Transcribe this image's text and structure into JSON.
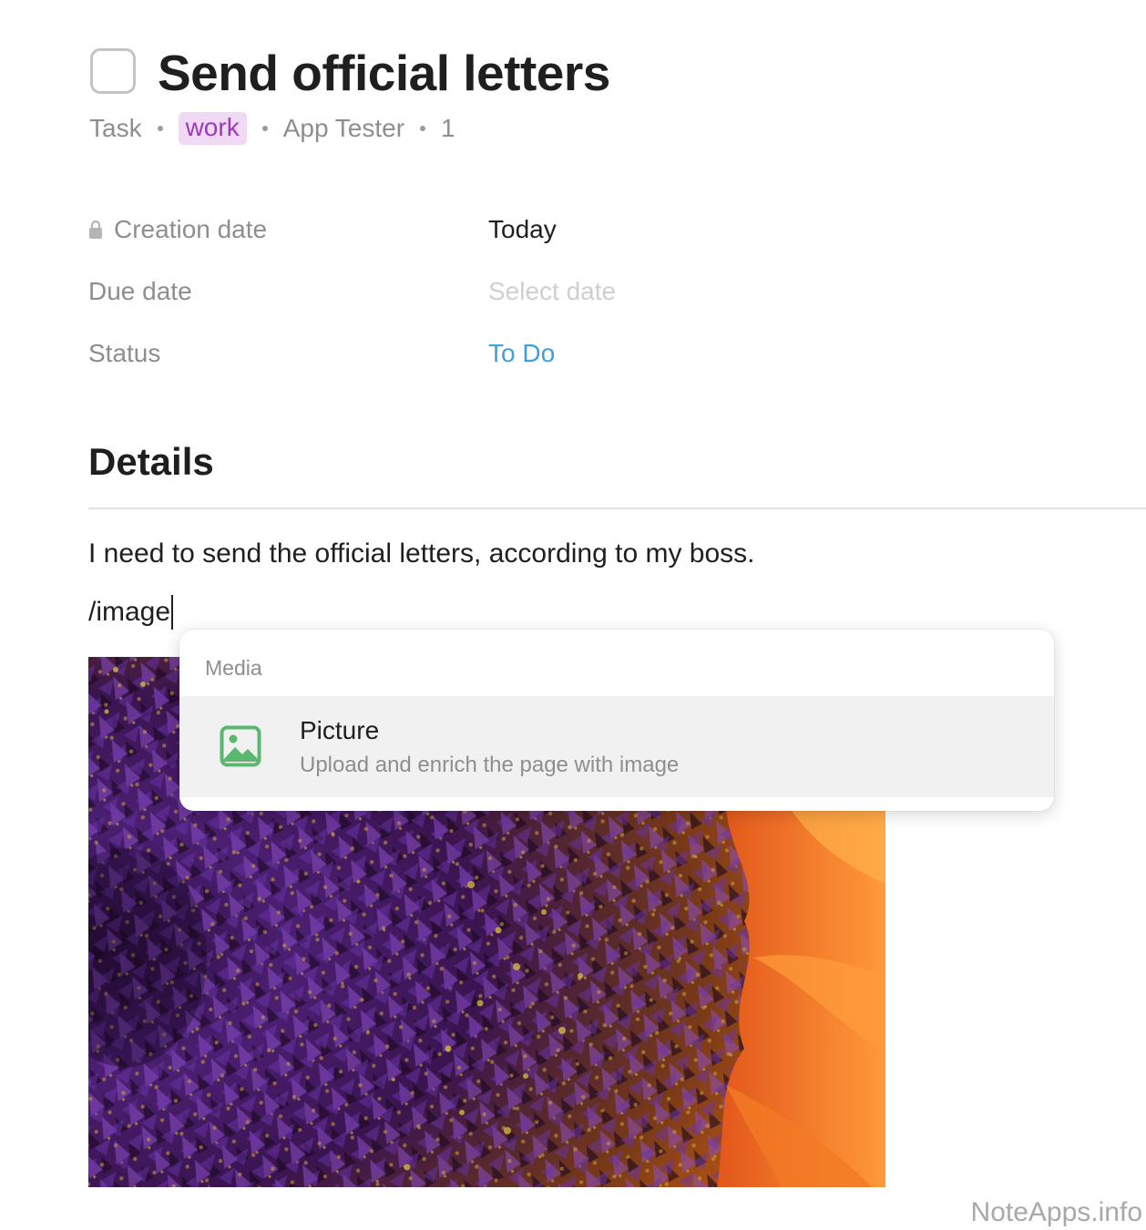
{
  "header": {
    "title": "Send official letters",
    "meta": {
      "type": "Task",
      "tag": "work",
      "owner": "App Tester",
      "count": "1"
    }
  },
  "properties": [
    {
      "label": "Creation date",
      "value": "Today",
      "icon": "lock-icon",
      "locked": true
    },
    {
      "label": "Due date",
      "value": "Select date",
      "placeholder": true
    },
    {
      "label": "Status",
      "value": "To Do"
    }
  ],
  "details": {
    "heading": "Details",
    "paragraph": "I need to send the official letters, according to my boss.",
    "command_input": "/image"
  },
  "command_menu": {
    "group_label": "Media",
    "items": [
      {
        "title": "Picture",
        "description": "Upload and enrich the page with image",
        "icon": "image-icon"
      }
    ]
  },
  "watermark": "NoteApps.info",
  "colors": {
    "tag_background": "#efd9f5",
    "tag_text": "#9b3bb8",
    "status_link": "#3d9fdc",
    "picture_icon": "#5cb870",
    "menu_highlight": "#f1f1f1"
  }
}
